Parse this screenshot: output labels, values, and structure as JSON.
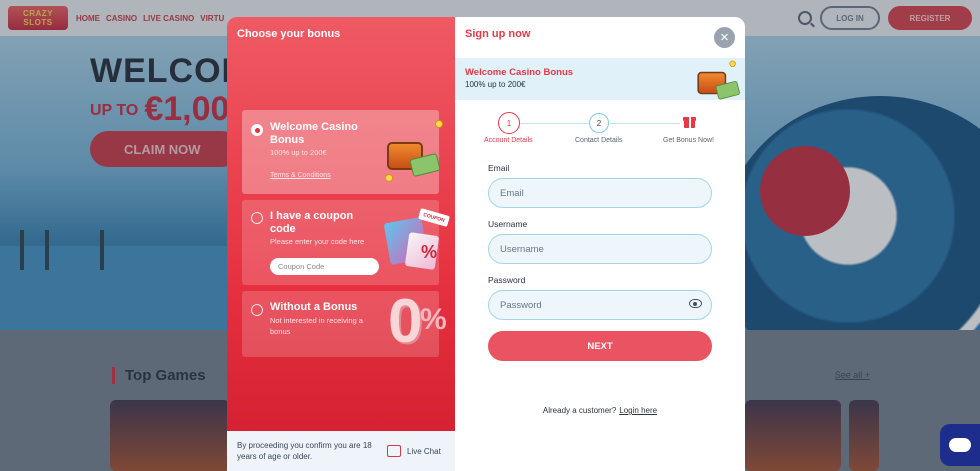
{
  "site": {
    "logo_text": "CRAZY SLOTS",
    "nav": [
      "HOME",
      "CASINO",
      "LIVE CASINO",
      "VIRTU"
    ],
    "login_label": "LOG IN",
    "register_label": "REGISTER",
    "hero_title": "WELCOM",
    "hero_up_to": "UP TO",
    "hero_amount": "€1,00",
    "claim_label": "CLAIM NOW",
    "top_games_label": "Top Games",
    "see_all_label": "See all +"
  },
  "modal": {
    "left_title": "Choose your bonus",
    "bonus_options": [
      {
        "title": "Welcome Casino Bonus",
        "desc": "100% up to 200€",
        "link": "Terms & Conditions",
        "selected": true
      },
      {
        "title": "I have a coupon code",
        "desc": "Please enter your code here",
        "input_placeholder": "Coupon Code",
        "selected": false
      },
      {
        "title": "Without a Bonus",
        "desc": "Not interested in receiving a bonus",
        "selected": false
      }
    ],
    "coupon_tag": "COUPON",
    "footer_text": "By proceeding you confirm you are 18 years of age or older.",
    "live_chat_label": "Live Chat",
    "right_title": "Sign up now",
    "close_symbol": "×",
    "banner_title": "Welcome Casino Bonus",
    "banner_sub": "100% up to 200€",
    "steps": [
      {
        "num": "1",
        "label": "Account Details"
      },
      {
        "num": "2",
        "label": "Contact Details"
      },
      {
        "num": "",
        "label": "Get Bonus Now!"
      }
    ],
    "fields": {
      "email_label": "Email",
      "email_placeholder": "Email",
      "username_label": "Username",
      "username_placeholder": "Username",
      "password_label": "Password",
      "password_placeholder": "Password"
    },
    "next_label": "NEXT",
    "already_text": "Already a customer?",
    "login_link": "Login here"
  },
  "colors": {
    "accent": "#e63946",
    "left_panel": "#e6303f",
    "field_border": "#9fd7e9"
  }
}
